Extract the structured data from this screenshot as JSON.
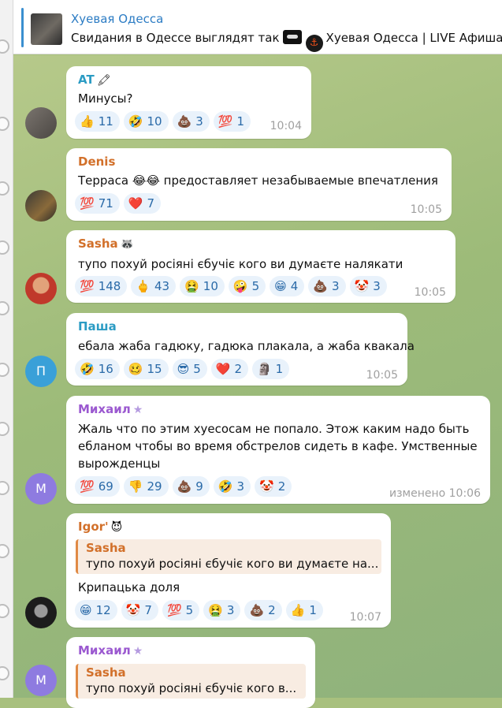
{
  "pinned": {
    "title": "Хуевая Одесса",
    "text_part1": "Свидания в Одессе выглядят так",
    "text_part2": "Хуевая Одесса | LIVE Афиша |"
  },
  "messages": [
    {
      "author": "AT",
      "author_color": "#2c9cc4",
      "author_badge": "🖍",
      "text": "Минусы?",
      "reactions": [
        {
          "emoji": "👍",
          "count": "11"
        },
        {
          "emoji": "🤣",
          "count": "10"
        },
        {
          "emoji": "💩",
          "count": "3"
        },
        {
          "emoji": "💯",
          "count": "1"
        }
      ],
      "time": "10:04"
    },
    {
      "author": "Denis",
      "author_color": "#d2702a",
      "text": "Терраса 😂😂 предоставляет незабываемые впечатления",
      "reactions": [
        {
          "emoji": "💯",
          "count": "71"
        },
        {
          "emoji": "❤️",
          "count": "7"
        }
      ],
      "time": "10:05"
    },
    {
      "author": "Sasha",
      "author_color": "#d2702a",
      "author_badge": "🦝",
      "text": "тупо похуй росіяні єбучіє кого ви думаєте налякати",
      "reactions": [
        {
          "emoji": "💯",
          "count": "148"
        },
        {
          "emoji": "🖕",
          "count": "43"
        },
        {
          "emoji": "🤮",
          "count": "10"
        },
        {
          "emoji": "🤪",
          "count": "5"
        },
        {
          "emoji": "😁",
          "count": "4"
        },
        {
          "emoji": "💩",
          "count": "3"
        },
        {
          "emoji": "🤡",
          "count": "3"
        }
      ],
      "time": "10:05"
    },
    {
      "author": "Паша",
      "author_color": "#2c9cc4",
      "avatar_letter": "П",
      "text": "ебала жаба гадюку, гадюка плакала, а жаба квакала",
      "reactions": [
        {
          "emoji": "🤣",
          "count": "16"
        },
        {
          "emoji": "🥴",
          "count": "15"
        },
        {
          "emoji": "😎",
          "count": "5"
        },
        {
          "emoji": "❤️",
          "count": "2"
        },
        {
          "emoji": "🗿",
          "count": "1"
        }
      ],
      "time": "10:05"
    },
    {
      "author": "Михаил",
      "author_color": "#9b59d0",
      "author_badge": "★",
      "avatar_letter": "М",
      "text": "Жаль что по этим хуесосам не попало. Этож каким надо быть ебланом чтобы во время обстрелов сидеть в кафе. Умственные вырожденцы",
      "reactions": [
        {
          "emoji": "💯",
          "count": "69"
        },
        {
          "emoji": "👎",
          "count": "29"
        },
        {
          "emoji": "💩",
          "count": "9"
        },
        {
          "emoji": "🤣",
          "count": "3"
        },
        {
          "emoji": "🤡",
          "count": "2"
        }
      ],
      "time": "изменено 10:06"
    },
    {
      "author": "Igor'",
      "author_color": "#d2702a",
      "author_badge": "😈",
      "reply_name": "Sasha",
      "reply_text": "тупо похуй росіяні єбучіє кого ви думаєте на...",
      "text": "Крипацька доля",
      "reactions": [
        {
          "emoji": "😁",
          "count": "12"
        },
        {
          "emoji": "🤡",
          "count": "7"
        },
        {
          "emoji": "💯",
          "count": "5"
        },
        {
          "emoji": "🤮",
          "count": "3"
        },
        {
          "emoji": "💩",
          "count": "2"
        },
        {
          "emoji": "👍",
          "count": "1"
        }
      ],
      "time": "10:07"
    },
    {
      "author": "Михаил",
      "author_color": "#9b59d0",
      "author_badge": "★",
      "avatar_letter": "М",
      "reply_name": "Sasha",
      "reply_text": "тупо похуй росіяні єбучіє кого в..."
    }
  ]
}
